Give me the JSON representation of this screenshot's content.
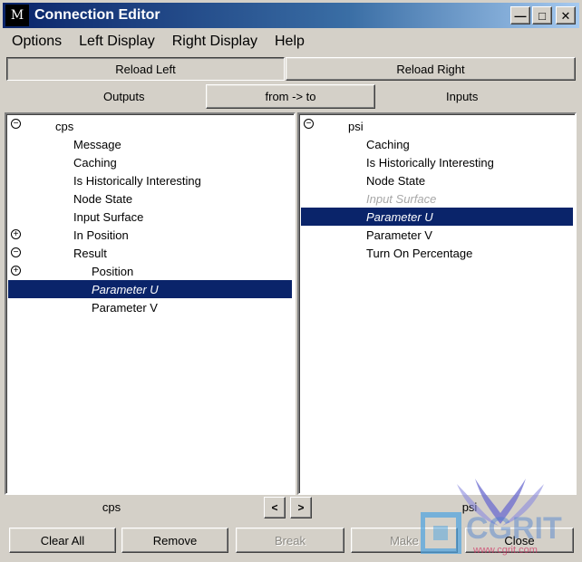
{
  "window": {
    "title": "Connection Editor",
    "icon": "maya-icon"
  },
  "title_buttons": {
    "minimize": "—",
    "maximize": "□",
    "close": "✕"
  },
  "menu": [
    "Options",
    "Left Display",
    "Right Display",
    "Help"
  ],
  "toolbar": {
    "reload_left": "Reload Left",
    "reload_right": "Reload Right"
  },
  "header": {
    "outputs": "Outputs",
    "direction": "from -> to",
    "inputs": "Inputs"
  },
  "left_panel": {
    "node": "cps",
    "items": [
      {
        "label": "Message",
        "state": "normal"
      },
      {
        "label": "Caching",
        "state": "normal"
      },
      {
        "label": "Is Historically Interesting",
        "state": "normal"
      },
      {
        "label": "Node State",
        "state": "normal"
      },
      {
        "label": "Input Surface",
        "state": "normal"
      },
      {
        "label": "In Position",
        "state": "collapsed"
      },
      {
        "label": "Result",
        "state": "expanded"
      },
      {
        "label": "Position",
        "state": "collapsed"
      },
      {
        "label": "Parameter U",
        "state": "selected"
      },
      {
        "label": "Parameter V",
        "state": "normal"
      }
    ]
  },
  "right_panel": {
    "node": "psi",
    "items": [
      {
        "label": "Caching",
        "state": "normal"
      },
      {
        "label": "Is Historically Interesting",
        "state": "normal"
      },
      {
        "label": "Node State",
        "state": "normal"
      },
      {
        "label": "Input Surface",
        "state": "dim"
      },
      {
        "label": "Parameter U",
        "state": "selected"
      },
      {
        "label": "Parameter V",
        "state": "normal"
      },
      {
        "label": "Turn On Percentage",
        "state": "normal"
      }
    ]
  },
  "status": {
    "left": "cps",
    "right": "psi",
    "prev": "<",
    "next": ">"
  },
  "footer": {
    "clear_all": "Clear All",
    "remove": "Remove",
    "break": "Break",
    "make": "Make",
    "close": "Close"
  },
  "watermark": {
    "text": "CGRIT",
    "url": "www.cgrit.com"
  },
  "colors": {
    "selection": "#0a246a",
    "face": "#d4d0c8",
    "title_start": "#0a246a"
  }
}
